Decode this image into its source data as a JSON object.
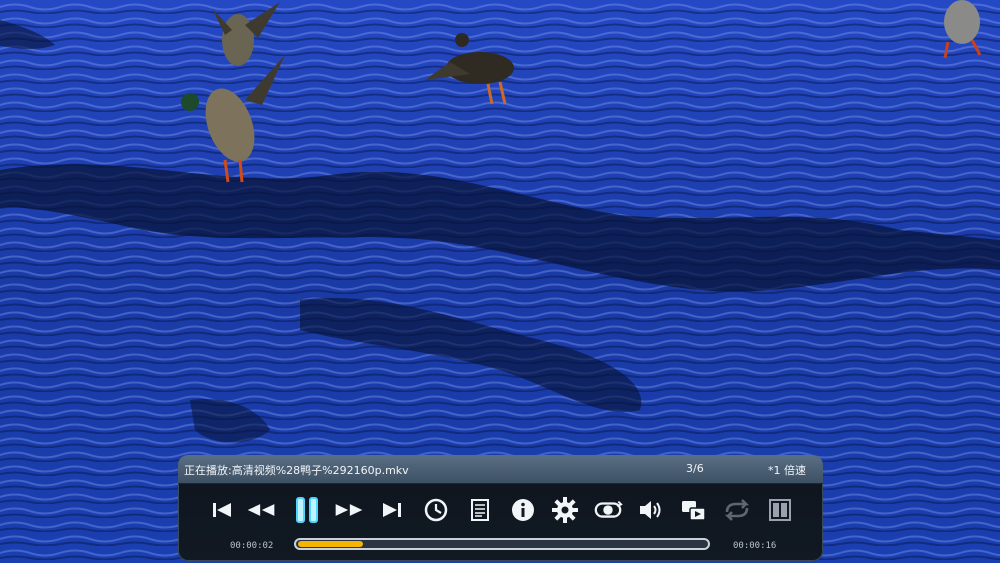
{
  "video": {
    "description_colors": {
      "water": "#1b3fb8",
      "water_dark": "#0a1a55",
      "highlight": "#9fb6ff"
    }
  },
  "player": {
    "now_playing_label": "正在播放:",
    "file_name": "高清视频%28鸭子%292160p.mkv",
    "playlist_position": "3/6",
    "speed": "*1 倍速",
    "elapsed": "00:00:02",
    "duration": "00:00:16",
    "progress_fraction": 0.16,
    "accent_color": "#f5b400",
    "controls": [
      {
        "name": "previous-track-icon"
      },
      {
        "name": "rewind-icon"
      },
      {
        "name": "pause-icon"
      },
      {
        "name": "fast-forward-icon"
      },
      {
        "name": "next-track-icon"
      },
      {
        "name": "clock-icon"
      },
      {
        "name": "playlist-icon"
      },
      {
        "name": "info-icon"
      },
      {
        "name": "settings-gear-icon"
      },
      {
        "name": "ab-repeat-icon"
      },
      {
        "name": "volume-icon"
      },
      {
        "name": "subtitle-switch-icon"
      },
      {
        "name": "repeat-disabled-icon"
      },
      {
        "name": "aspect-ratio-icon"
      }
    ]
  }
}
